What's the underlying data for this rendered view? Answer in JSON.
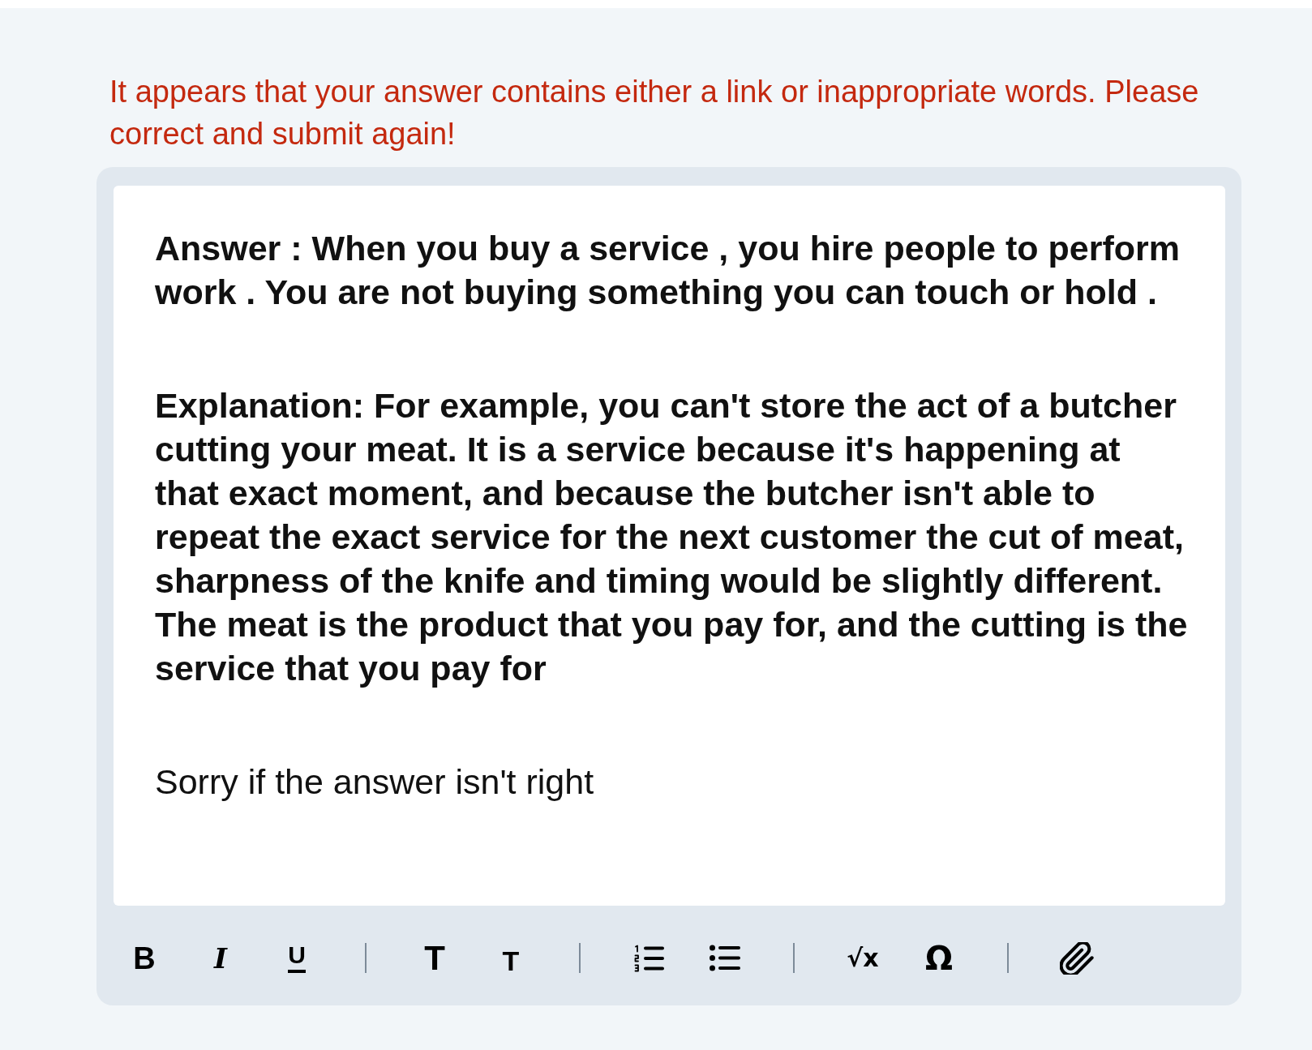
{
  "error_message": "It appears that your answer contains either a link or inappropriate words. Please correct and submit again!",
  "editor": {
    "paragraphs": [
      {
        "text": "Answer : When you buy a service , you hire people to perform work . You are not buying something you can touch or hold .",
        "bold": true
      },
      {
        "text": "Explanation: For example, you can't store the act of a butcher cutting your meat. It is a service because it's happening at that exact moment, and because the butcher isn't able to repeat the exact service for the next customer the cut of meat, sharpness of the knife and timing would be slightly different. The meat is the product that you pay for, and the cutting is the service that you pay for",
        "bold": true
      },
      {
        "text": "Sorry if the answer isn't right",
        "bold": false
      }
    ]
  },
  "toolbar": {
    "groups": [
      {
        "items": [
          {
            "kind": "bold",
            "label": "B"
          },
          {
            "kind": "italic",
            "label": "I"
          },
          {
            "kind": "underline",
            "label": "U"
          }
        ]
      },
      {
        "items": [
          {
            "kind": "heading",
            "label": "T"
          },
          {
            "kind": "subheading",
            "label": "T"
          }
        ]
      },
      {
        "items": [
          {
            "kind": "numbered_list"
          },
          {
            "kind": "bullet_list"
          }
        ]
      },
      {
        "items": [
          {
            "kind": "formula",
            "label": "√x"
          },
          {
            "kind": "symbol",
            "label": "Ω"
          }
        ]
      },
      {
        "items": [
          {
            "kind": "attachment"
          }
        ]
      }
    ]
  }
}
